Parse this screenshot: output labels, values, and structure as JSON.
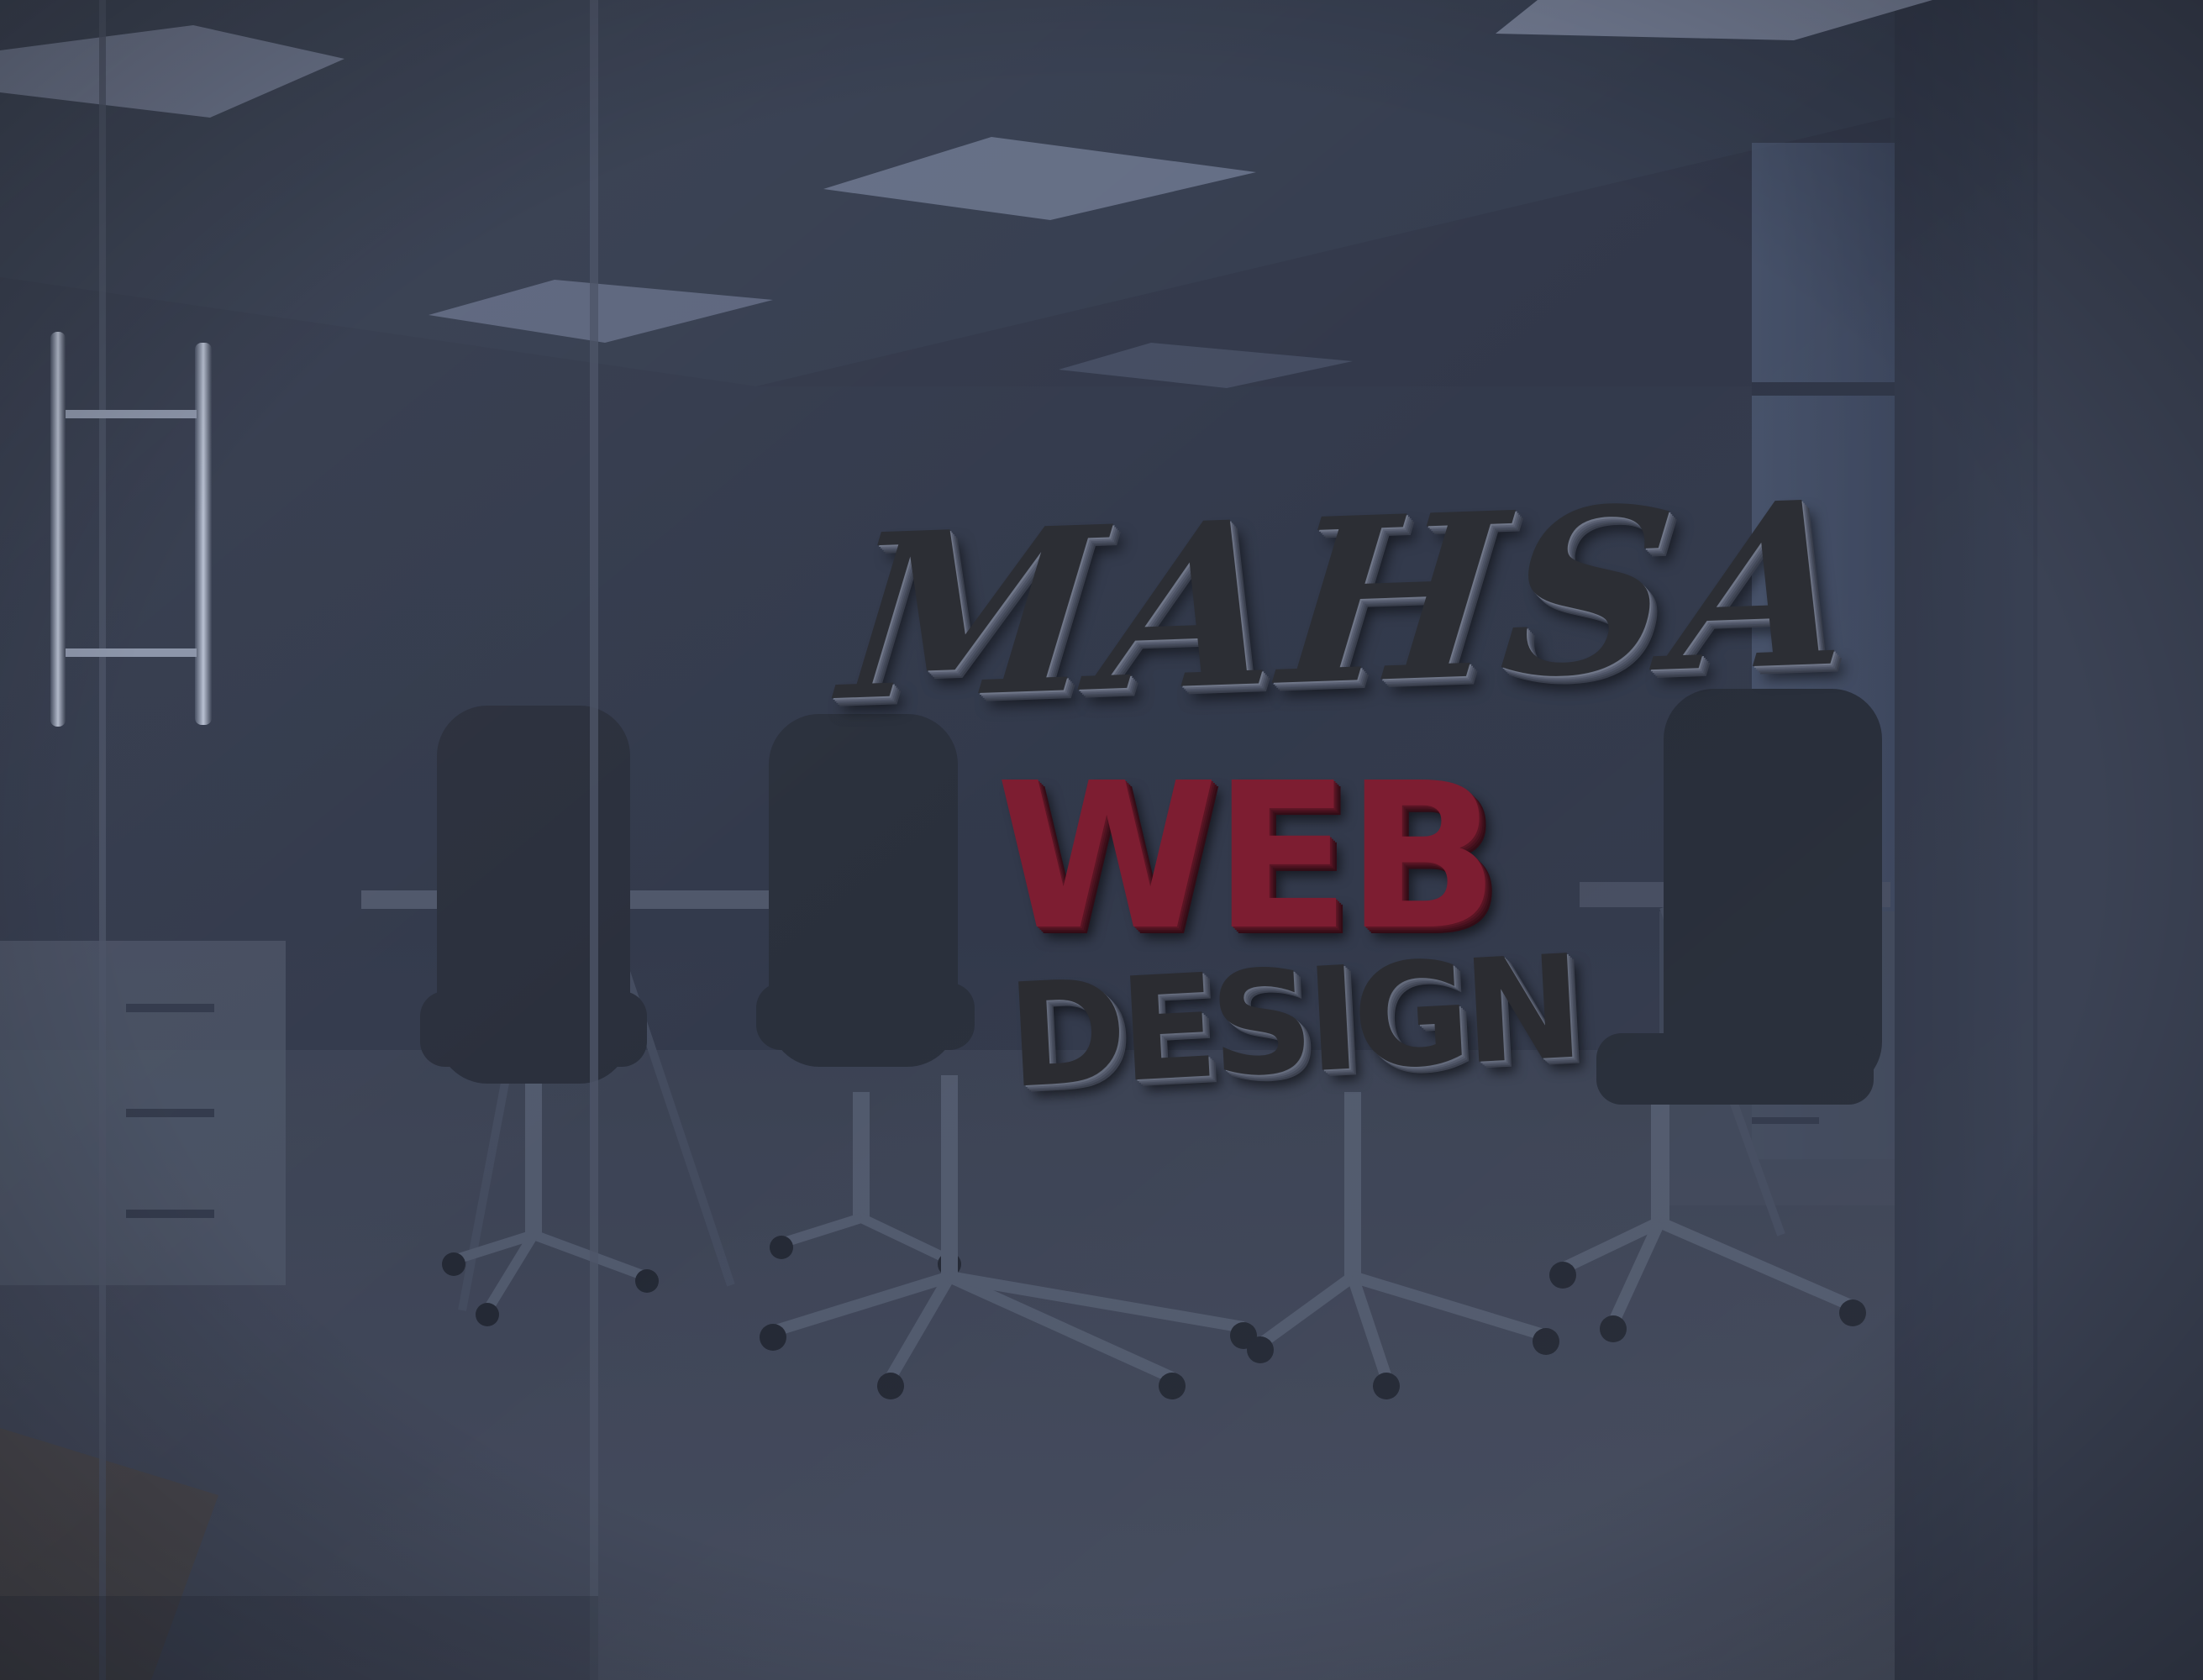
{
  "logo": {
    "brand": "MAHSA",
    "line2": "WEB",
    "line3": "DESIGN"
  },
  "colors": {
    "wall": "#2b3142",
    "glass_tint": "#3a4256",
    "ceiling_light": "#8a93ab",
    "floor": "#3e4454",
    "web_red": "#7d1d31",
    "letter_dark": "#2c2e34"
  },
  "icons": [
    "door-handle-icon"
  ]
}
